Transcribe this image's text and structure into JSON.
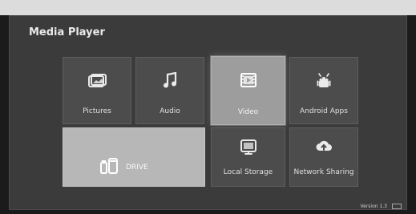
{
  "header": {
    "title": "Media Player"
  },
  "tiles": [
    {
      "label": "Pictures"
    },
    {
      "label": "Audio"
    },
    {
      "label": "Video"
    },
    {
      "label": "Android Apps"
    },
    {
      "label": "DRIVE"
    },
    {
      "label": "Local Storage"
    },
    {
      "label": "Network Sharing"
    }
  ],
  "footer": {
    "version": "Version 1.3"
  },
  "icons": {
    "pictures": "pictures-icon",
    "audio": "music-note-icon",
    "video": "film-icon",
    "android": "android-icon",
    "drive": "usb-drive-icon",
    "local": "local-storage-icon",
    "network": "network-cloud-icon"
  }
}
